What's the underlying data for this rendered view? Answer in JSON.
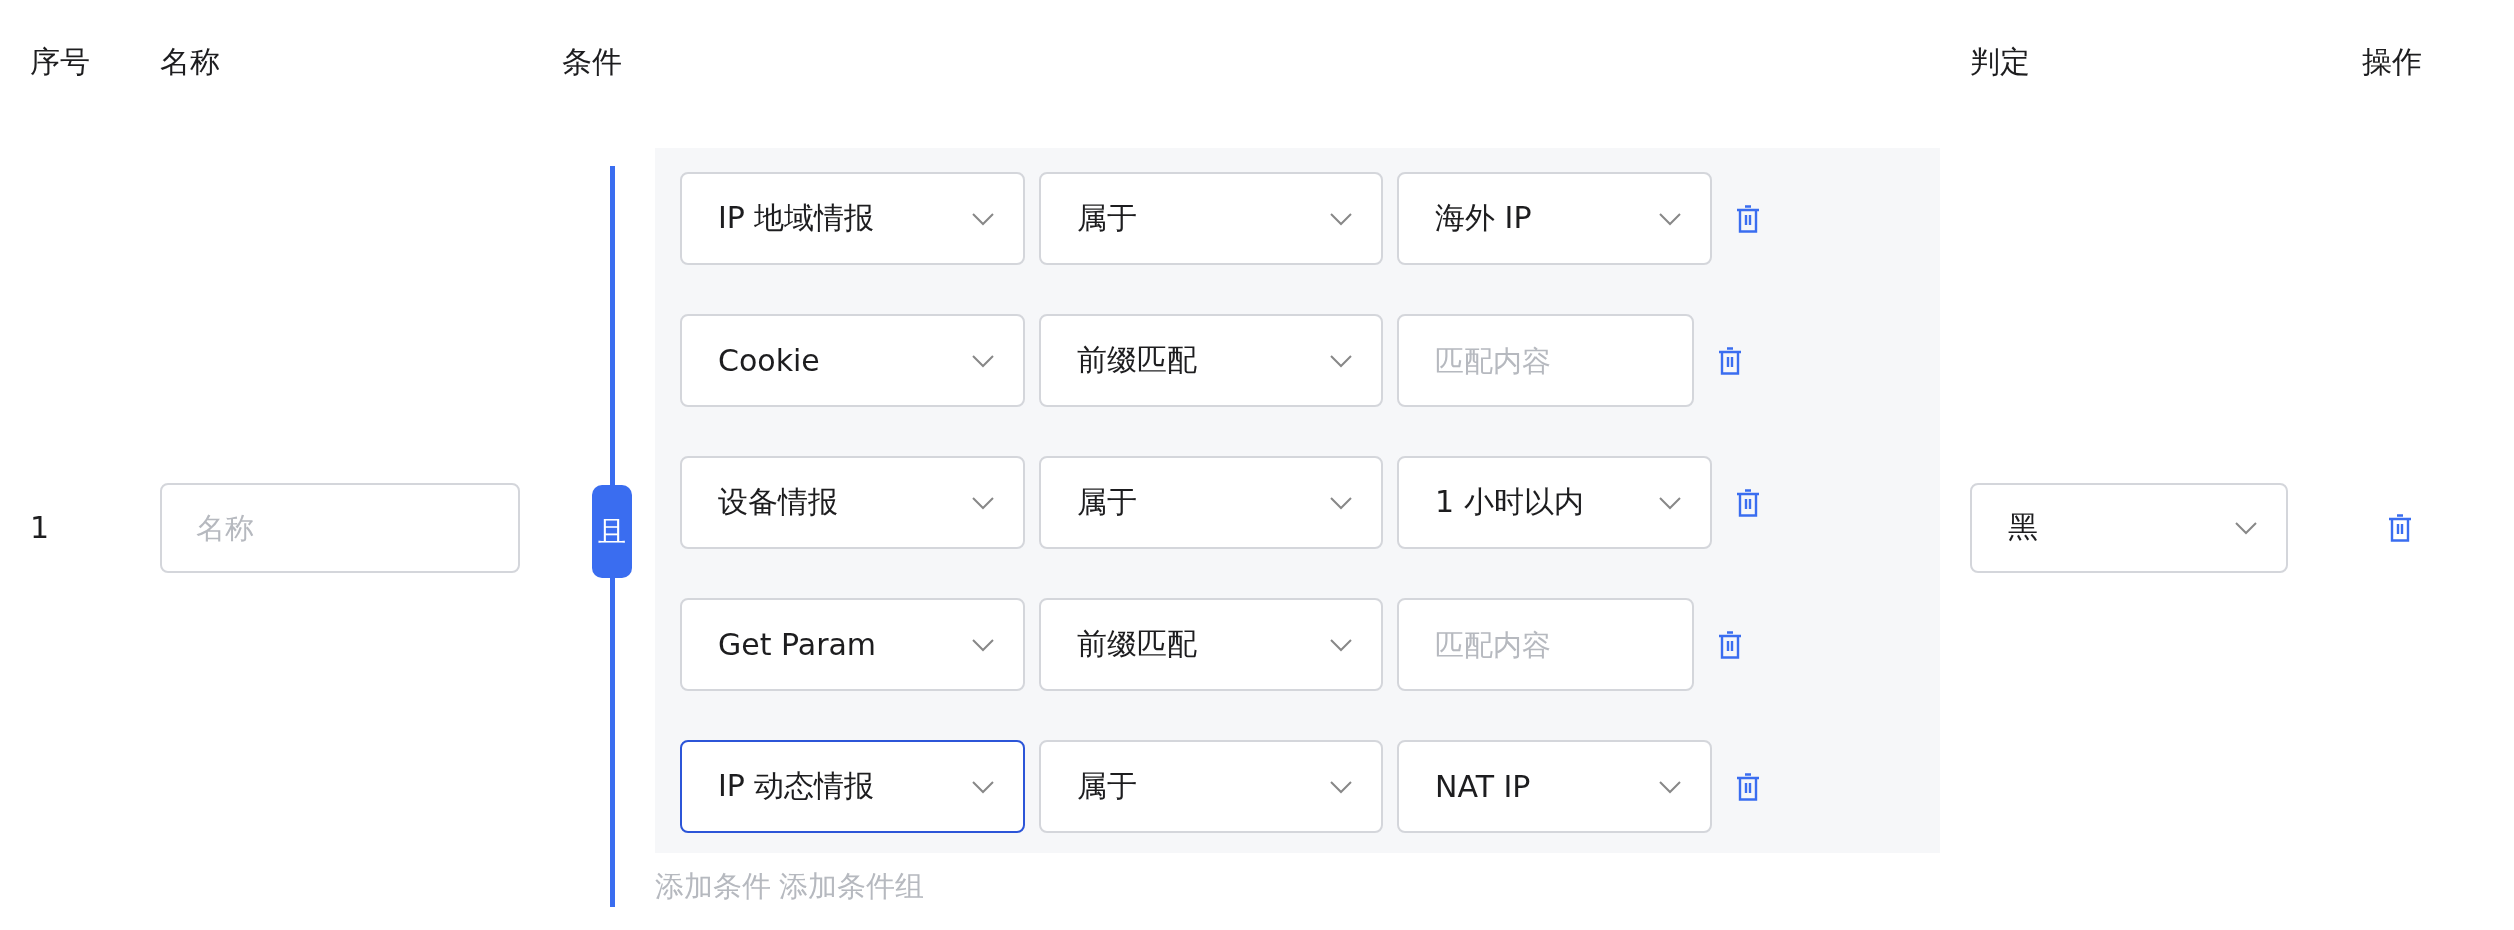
{
  "columns": [
    "序号",
    "名称",
    "条件",
    "判定",
    "操作"
  ],
  "rows": [
    {
      "index": "1",
      "name": {
        "placeholder": "名称"
      },
      "logic": "且",
      "conditions": [
        {
          "field": {
            "value": "IP 地域情报",
            "focused": false
          },
          "operator": {
            "value": "属于"
          },
          "target": {
            "kind": "select",
            "value": "海外 IP"
          }
        },
        {
          "field": {
            "value": "Cookie",
            "focused": false
          },
          "operator": {
            "value": "前缀匹配"
          },
          "target": {
            "kind": "input",
            "placeholder": "匹配内容"
          }
        },
        {
          "field": {
            "value": "设备情报",
            "focused": false
          },
          "operator": {
            "value": "属于"
          },
          "target": {
            "kind": "select",
            "value": "1 小时以内"
          }
        },
        {
          "field": {
            "value": "Get Param",
            "focused": false
          },
          "operator": {
            "value": "前缀匹配"
          },
          "target": {
            "kind": "input",
            "placeholder": "匹配内容"
          }
        },
        {
          "field": {
            "value": "IP 动态情报",
            "focused": true
          },
          "operator": {
            "value": "属于"
          },
          "target": {
            "kind": "select",
            "value": "NAT IP"
          }
        }
      ],
      "add_links": [
        "添加条件",
        "添加条件组"
      ],
      "verdict": "黑"
    }
  ]
}
